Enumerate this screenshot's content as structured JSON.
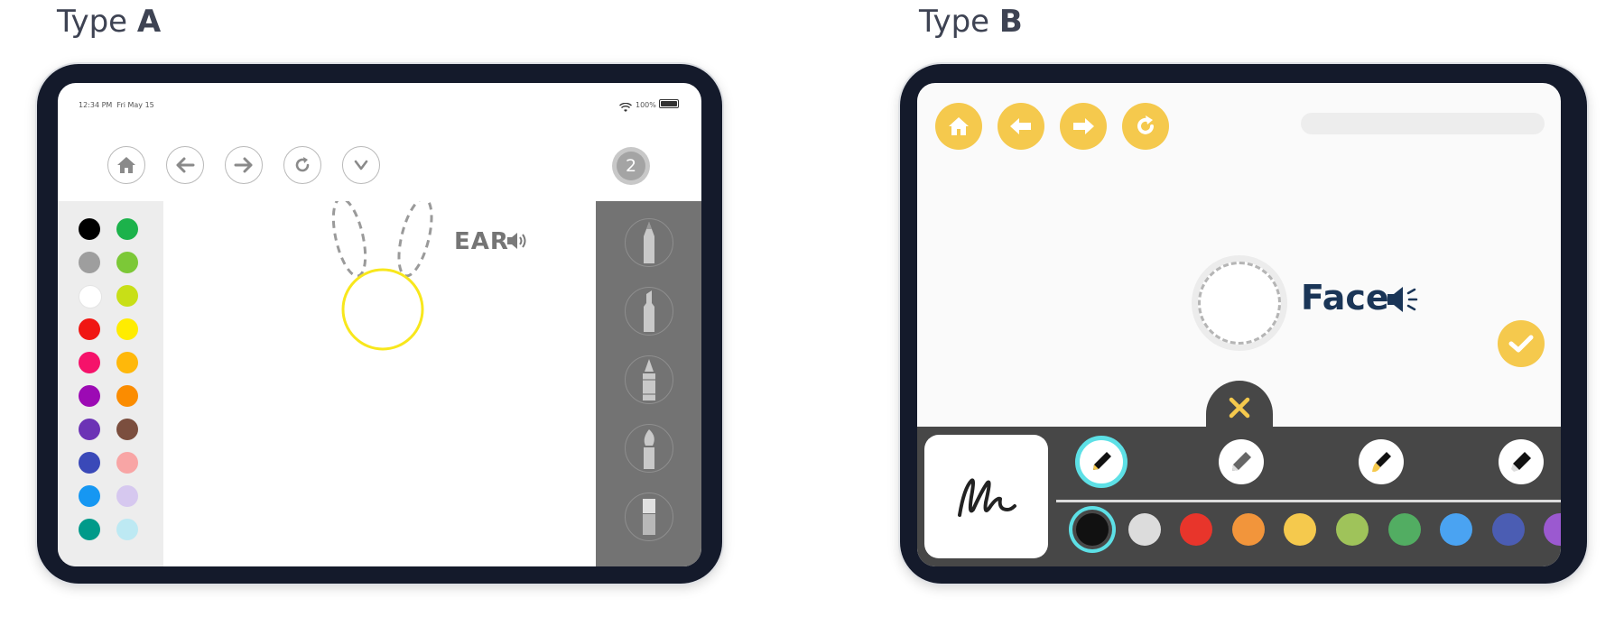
{
  "type_a": {
    "label_prefix": "Type ",
    "label_letter": "A",
    "status_bar": {
      "time": "12:34 PM",
      "date": "Fri May 15",
      "battery": "100%"
    },
    "page_badge": "2",
    "word": "EAR",
    "palette_colors": [
      "#000000",
      "#1cb24b",
      "#9e9e9e",
      "#7cc837",
      "#ffffff",
      "#c8df17",
      "#f01612",
      "#ffec00",
      "#f5126a",
      "#ffb80a",
      "#9c0ab4",
      "#fb8c00",
      "#6c33b5",
      "#7b4e3e",
      "#3a49b8",
      "#f8a5a5",
      "#1697f2",
      "#d6c8ef",
      "#009a8a",
      "#bde9f3"
    ],
    "nav_icons": [
      "home-icon",
      "arrow-left-icon",
      "arrow-right-icon",
      "redo-icon",
      "chevron-down-icon"
    ],
    "tools": [
      "pencil-icon",
      "marker-icon",
      "crayon-icon",
      "brush-icon",
      "eraser-icon"
    ],
    "stroke_color": "#f8e71c",
    "canvas_bg": "#ffffff",
    "panel_gray": "#737373"
  },
  "type_b": {
    "label_prefix": "Type ",
    "label_letter": "B",
    "word": "Face",
    "accent": "#f5c94d",
    "word_color": "#1a3557",
    "nav_icons": [
      "home-icon",
      "arrow-left-icon",
      "arrow-right-icon",
      "redo-icon"
    ],
    "tools": [
      "pen-icon",
      "pencil-icon",
      "brush-icon",
      "marker-icon"
    ],
    "palette_colors": [
      "#111111",
      "#dcdcdc",
      "#e8352b",
      "#f2953b",
      "#f5c94d",
      "#9fc35a",
      "#52ad62",
      "#4aa3f2",
      "#4b5db3",
      "#9b59d0"
    ],
    "selected_color_ring": "#5de0e6",
    "toolbar_bg": "#474747"
  }
}
